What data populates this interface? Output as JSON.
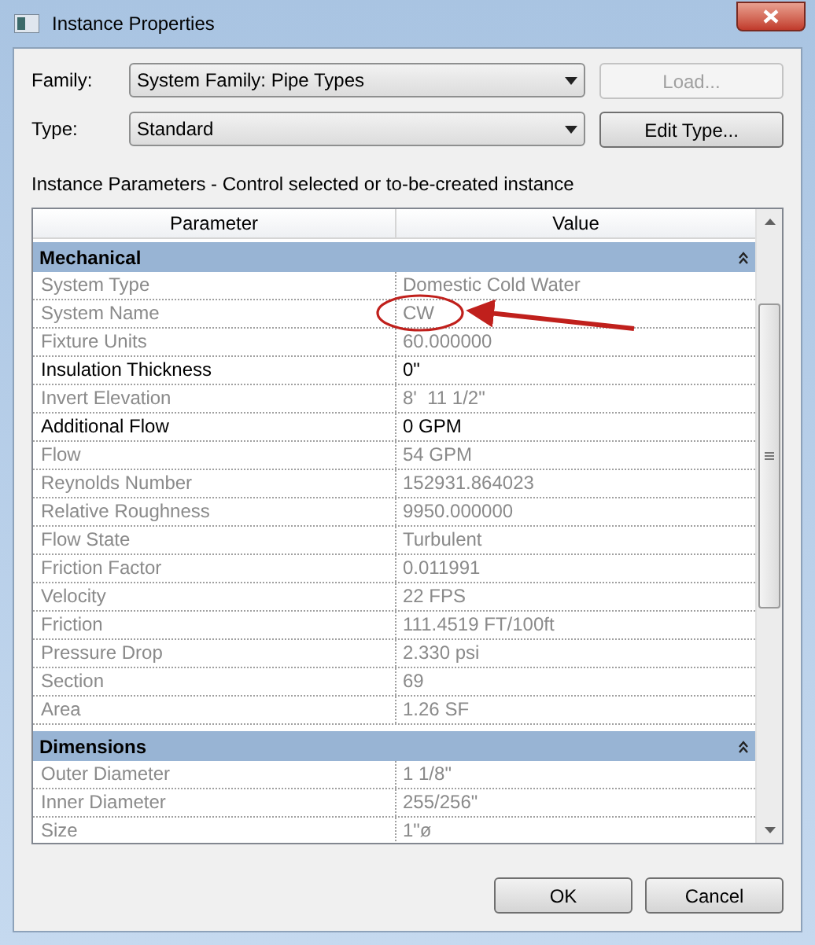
{
  "window": {
    "title": "Instance Properties"
  },
  "family": {
    "label": "Family:",
    "value": "System Family: Pipe Types"
  },
  "type": {
    "label": "Type:",
    "value": "Standard"
  },
  "load_button": {
    "label": "Load...",
    "disabled": true
  },
  "edit_type_button": {
    "label": "Edit Type...",
    "disabled": false
  },
  "section_label": "Instance Parameters - Control selected or to-be-created instance",
  "table": {
    "columns": [
      "Parameter",
      "Value"
    ],
    "groups": [
      {
        "name": "Mechanical",
        "expanded": true,
        "rows": [
          {
            "parameter": "System Type",
            "value": "Domestic Cold Water",
            "editable": false
          },
          {
            "parameter": "System Name",
            "value": "CW",
            "editable": false
          },
          {
            "parameter": "Fixture Units",
            "value": "60.000000",
            "editable": false
          },
          {
            "parameter": "Insulation Thickness",
            "value": "0\"",
            "editable": true
          },
          {
            "parameter": "Invert Elevation",
            "value": "8'  11 1/2\"",
            "editable": false
          },
          {
            "parameter": "Additional Flow",
            "value": "0 GPM",
            "editable": true
          },
          {
            "parameter": "Flow",
            "value": "54 GPM",
            "editable": false
          },
          {
            "parameter": "Reynolds Number",
            "value": "152931.864023",
            "editable": false
          },
          {
            "parameter": "Relative Roughness",
            "value": "9950.000000",
            "editable": false
          },
          {
            "parameter": "Flow State",
            "value": "Turbulent",
            "editable": false
          },
          {
            "parameter": "Friction Factor",
            "value": "0.011991",
            "editable": false
          },
          {
            "parameter": "Velocity",
            "value": "22 FPS",
            "editable": false
          },
          {
            "parameter": "Friction",
            "value": "111.4519 FT/100ft",
            "editable": false
          },
          {
            "parameter": "Pressure Drop",
            "value": "2.330 psi",
            "editable": false
          },
          {
            "parameter": "Section",
            "value": "69",
            "editable": false
          },
          {
            "parameter": "Area",
            "value": "1.26 SF",
            "editable": false
          }
        ]
      },
      {
        "name": "Dimensions",
        "expanded": true,
        "rows": [
          {
            "parameter": "Outer Diameter",
            "value": "1 1/8\"",
            "editable": false
          },
          {
            "parameter": "Inner Diameter",
            "value": "255/256\"",
            "editable": false
          },
          {
            "parameter": "Size",
            "value": "1\"ø",
            "editable": false
          }
        ]
      }
    ]
  },
  "buttons": [
    {
      "label": "OK"
    },
    {
      "label": "Cancel"
    }
  ]
}
